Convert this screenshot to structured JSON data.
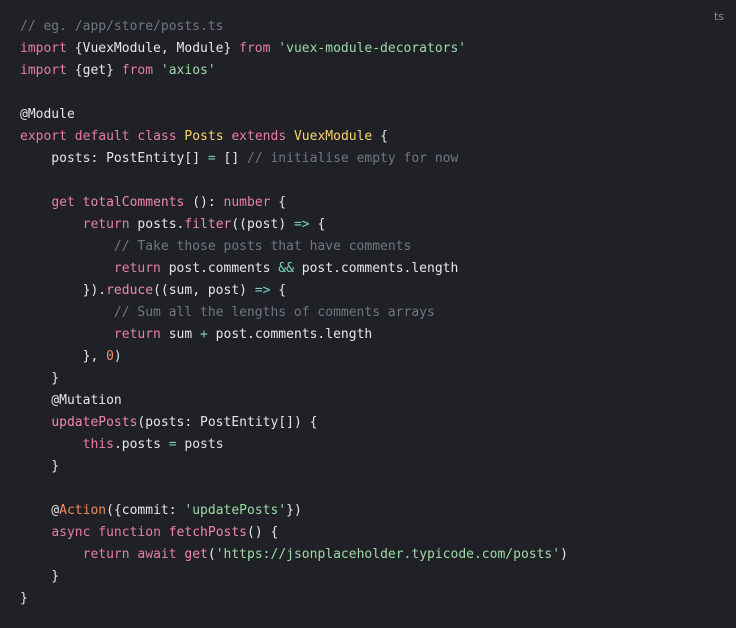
{
  "code_block": {
    "language": "ts",
    "lines": [
      [
        {
          "t": "// eg. /app/store/posts.ts",
          "c": "c-comment"
        }
      ],
      [
        {
          "t": "import",
          "c": "c-kw"
        },
        {
          "t": " {VuexModule, Module} ",
          "c": "c-pl"
        },
        {
          "t": "from",
          "c": "c-kw"
        },
        {
          "t": " ",
          "c": "c-pl"
        },
        {
          "t": "'vuex-module-decorators'",
          "c": "c-str"
        }
      ],
      [
        {
          "t": "import",
          "c": "c-kw"
        },
        {
          "t": " {get} ",
          "c": "c-pl"
        },
        {
          "t": "from",
          "c": "c-kw"
        },
        {
          "t": " ",
          "c": "c-pl"
        },
        {
          "t": "'axios'",
          "c": "c-str"
        }
      ],
      [],
      [
        {
          "t": "@Module",
          "c": "c-pl"
        }
      ],
      [
        {
          "t": "export",
          "c": "c-kw"
        },
        {
          "t": " ",
          "c": "c-pl"
        },
        {
          "t": "default",
          "c": "c-kw"
        },
        {
          "t": " ",
          "c": "c-pl"
        },
        {
          "t": "class",
          "c": "c-kw"
        },
        {
          "t": " ",
          "c": "c-pl"
        },
        {
          "t": "Posts",
          "c": "c-cls"
        },
        {
          "t": " ",
          "c": "c-pl"
        },
        {
          "t": "extends",
          "c": "c-kw"
        },
        {
          "t": " ",
          "c": "c-pl"
        },
        {
          "t": "VuexModule",
          "c": "c-cls"
        },
        {
          "t": " {",
          "c": "c-pl"
        }
      ],
      [
        {
          "t": "    posts: ",
          "c": "c-pl"
        },
        {
          "t": "PostEntity",
          "c": "c-pl"
        },
        {
          "t": "[] ",
          "c": "c-pl"
        },
        {
          "t": "=",
          "c": "c-op"
        },
        {
          "t": " [] ",
          "c": "c-pl"
        },
        {
          "t": "// initialise empty for now",
          "c": "c-comment"
        }
      ],
      [],
      [
        {
          "t": "    ",
          "c": "c-pl"
        },
        {
          "t": "get",
          "c": "c-kw"
        },
        {
          "t": " ",
          "c": "c-pl"
        },
        {
          "t": "totalComments",
          "c": "c-fn"
        },
        {
          "t": " (): ",
          "c": "c-pl"
        },
        {
          "t": "number",
          "c": "c-kw"
        },
        {
          "t": " {",
          "c": "c-pl"
        }
      ],
      [
        {
          "t": "        ",
          "c": "c-pl"
        },
        {
          "t": "return",
          "c": "c-kw"
        },
        {
          "t": " posts.",
          "c": "c-pl"
        },
        {
          "t": "filter",
          "c": "c-fn"
        },
        {
          "t": "((post) ",
          "c": "c-pl"
        },
        {
          "t": "=>",
          "c": "c-op"
        },
        {
          "t": " {",
          "c": "c-pl"
        }
      ],
      [
        {
          "t": "            ",
          "c": "c-pl"
        },
        {
          "t": "// Take those posts that have comments",
          "c": "c-comment"
        }
      ],
      [
        {
          "t": "            ",
          "c": "c-pl"
        },
        {
          "t": "return",
          "c": "c-kw"
        },
        {
          "t": " post.comments ",
          "c": "c-pl"
        },
        {
          "t": "&&",
          "c": "c-op"
        },
        {
          "t": " post.comments.length",
          "c": "c-pl"
        }
      ],
      [
        {
          "t": "        }).",
          "c": "c-pl"
        },
        {
          "t": "reduce",
          "c": "c-fn"
        },
        {
          "t": "((sum, post) ",
          "c": "c-pl"
        },
        {
          "t": "=>",
          "c": "c-op"
        },
        {
          "t": " {",
          "c": "c-pl"
        }
      ],
      [
        {
          "t": "            ",
          "c": "c-pl"
        },
        {
          "t": "// Sum all the lengths of comments arrays",
          "c": "c-comment"
        }
      ],
      [
        {
          "t": "            ",
          "c": "c-pl"
        },
        {
          "t": "return",
          "c": "c-kw"
        },
        {
          "t": " sum ",
          "c": "c-pl"
        },
        {
          "t": "+",
          "c": "c-op"
        },
        {
          "t": " post.comments.length",
          "c": "c-pl"
        }
      ],
      [
        {
          "t": "        }, ",
          "c": "c-pl"
        },
        {
          "t": "0",
          "c": "c-num"
        },
        {
          "t": ")",
          "c": "c-pl"
        }
      ],
      [
        {
          "t": "    }",
          "c": "c-pl"
        }
      ],
      [
        {
          "t": "    @Mutation",
          "c": "c-pl"
        }
      ],
      [
        {
          "t": "    ",
          "c": "c-pl"
        },
        {
          "t": "updatePosts",
          "c": "c-fn"
        },
        {
          "t": "(posts: ",
          "c": "c-pl"
        },
        {
          "t": "PostEntity",
          "c": "c-pl"
        },
        {
          "t": "[]) {",
          "c": "c-pl"
        }
      ],
      [
        {
          "t": "        ",
          "c": "c-pl"
        },
        {
          "t": "this",
          "c": "c-kw"
        },
        {
          "t": ".posts ",
          "c": "c-pl"
        },
        {
          "t": "=",
          "c": "c-op"
        },
        {
          "t": " posts",
          "c": "c-pl"
        }
      ],
      [
        {
          "t": "    }",
          "c": "c-pl"
        }
      ],
      [],
      [
        {
          "t": "    @",
          "c": "c-pl"
        },
        {
          "t": "Action",
          "c": "c-deco"
        },
        {
          "t": "({commit: ",
          "c": "c-pl"
        },
        {
          "t": "'updatePosts'",
          "c": "c-str"
        },
        {
          "t": "})",
          "c": "c-pl"
        }
      ],
      [
        {
          "t": "    ",
          "c": "c-pl"
        },
        {
          "t": "async",
          "c": "c-kw"
        },
        {
          "t": " ",
          "c": "c-pl"
        },
        {
          "t": "function",
          "c": "c-kw"
        },
        {
          "t": " ",
          "c": "c-pl"
        },
        {
          "t": "fetchPosts",
          "c": "c-fn"
        },
        {
          "t": "() {",
          "c": "c-pl"
        }
      ],
      [
        {
          "t": "        ",
          "c": "c-pl"
        },
        {
          "t": "return",
          "c": "c-kw"
        },
        {
          "t": " ",
          "c": "c-pl"
        },
        {
          "t": "await",
          "c": "c-kw"
        },
        {
          "t": " ",
          "c": "c-pl"
        },
        {
          "t": "get",
          "c": "c-fn"
        },
        {
          "t": "(",
          "c": "c-pl"
        },
        {
          "t": "'https://jsonplaceholder.typicode.com/posts'",
          "c": "c-str"
        },
        {
          "t": ")",
          "c": "c-pl"
        }
      ],
      [
        {
          "t": "    }",
          "c": "c-pl"
        }
      ],
      [
        {
          "t": "}",
          "c": "c-pl"
        }
      ]
    ]
  },
  "colors": {
    "background": "#202127",
    "comment": "#6f7780",
    "keyword": "#e67ea1",
    "string": "#9ed9a6",
    "class": "#fcd36f",
    "operator": "#7dd3c0",
    "number": "#f08a5d",
    "plain": "#e6e6e6"
  }
}
